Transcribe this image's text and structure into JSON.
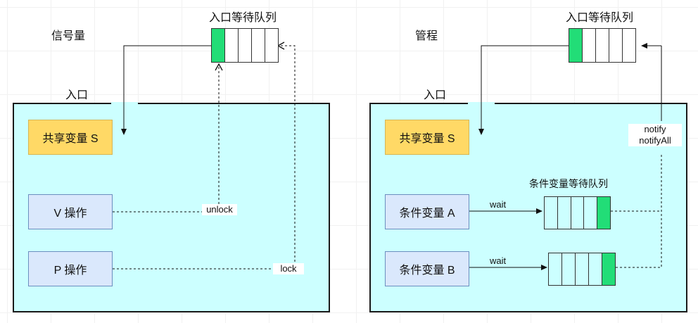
{
  "left": {
    "title": "信号量",
    "queue_label": "入口等待队列",
    "entry_label": "入口",
    "shared_var": "共享变量 S",
    "v_op": "V 操作",
    "p_op": "P 操作",
    "unlock_label": "unlock",
    "lock_label": "lock"
  },
  "right": {
    "title": "管程",
    "queue_label": "入口等待队列",
    "entry_label": "入口",
    "shared_var": "共享变量 S",
    "cond_a": "条件变量 A",
    "cond_b": "条件变量 B",
    "cond_queue_label": "条件变量等待队列",
    "wait_a": "wait",
    "wait_b": "wait",
    "notify": "notify",
    "notify_all": "notifyAll"
  },
  "colors": {
    "panel_fill": "#ccffff",
    "shared_fill": "#ffd966",
    "op_fill": "#dae8fc",
    "active_cell": "#22dd77"
  }
}
